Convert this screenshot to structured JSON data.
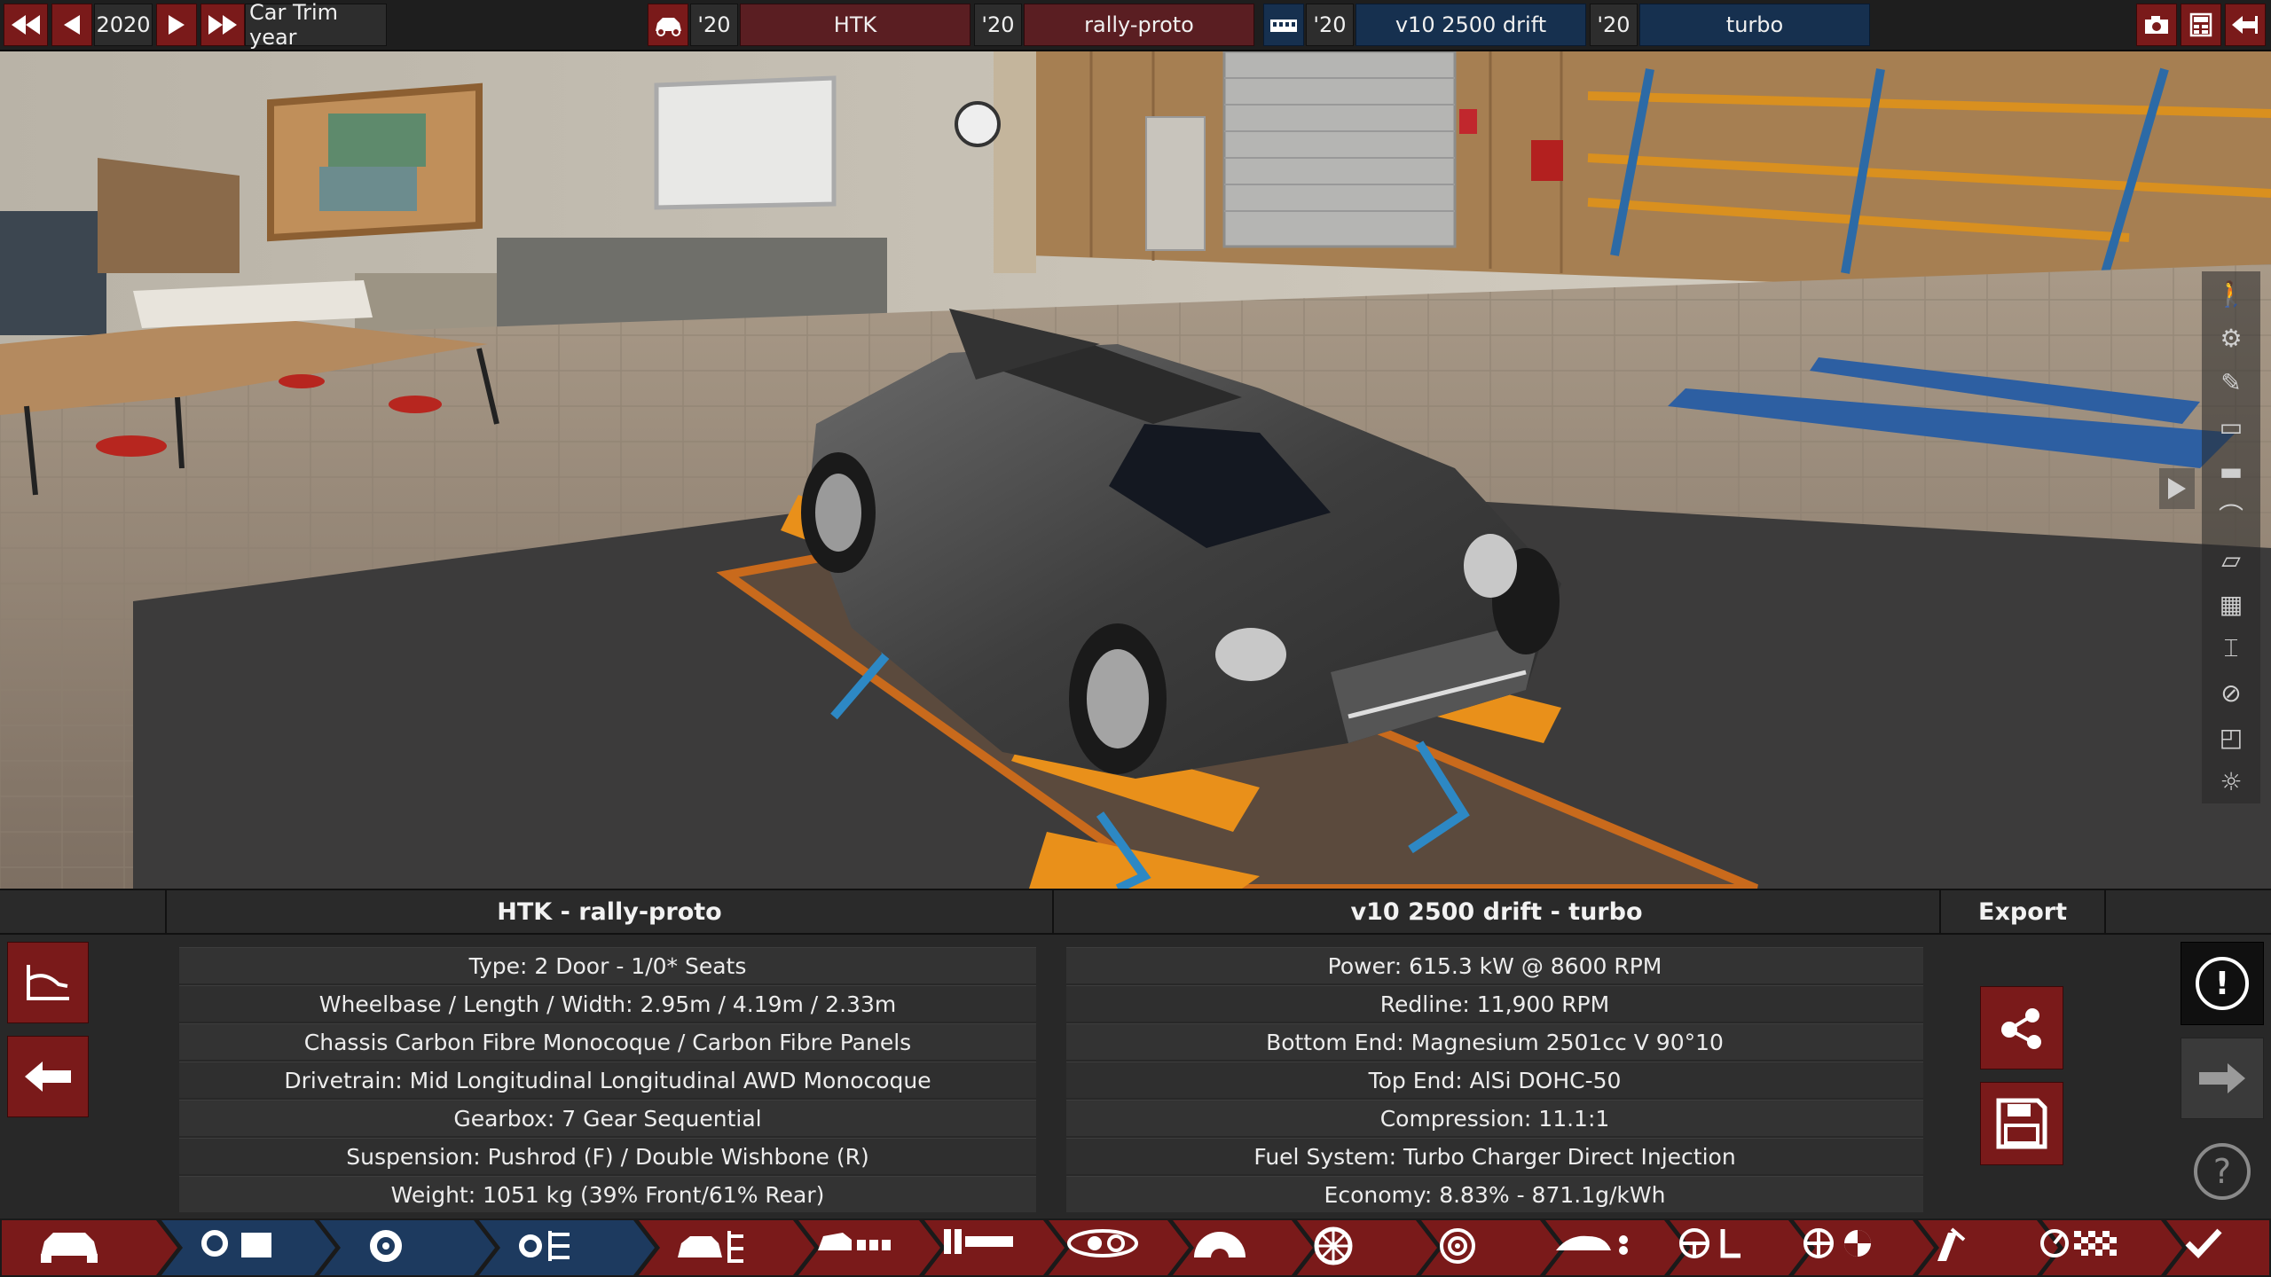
{
  "topbar": {
    "year": "2020",
    "trim_label": "Car Trim year",
    "car_year": "'20",
    "car_model": "HTK",
    "trim_year": "'20",
    "trim_name": "rally-proto",
    "engine_year": "'20",
    "engine_family": "v10 2500 drift",
    "variant_year": "'20",
    "engine_variant": "turbo"
  },
  "panel": {
    "car_title": "HTK - rally-proto",
    "car_specs": [
      "Type: 2 Door - 1/0* Seats",
      "Wheelbase / Length / Width: 2.95m / 4.19m / 2.33m",
      "Chassis Carbon Fibre Monocoque / Carbon Fibre Panels",
      "Drivetrain: Mid Longitudinal Longitudinal AWD Monocoque",
      "Gearbox: 7 Gear Sequential",
      "Suspension: Pushrod (F) / Double Wishbone (R)",
      "Weight: 1051 kg (39% Front/61% Rear)"
    ],
    "engine_title": "v10 2500 drift - turbo",
    "engine_specs": [
      "Power: 615.3 kW @ 8600 RPM",
      "Redline:  11,900 RPM",
      "Bottom End: Magnesium 2501cc V 90°10",
      "Top End: AlSi DOHC-50",
      "Compression: 11.1:1",
      "Fuel System: Turbo Charger Direct Injection",
      "Economy: 8.83% - 871.1g/kWh"
    ],
    "export_title": "Export"
  },
  "icons": {
    "exclaim": "!",
    "help": "?"
  },
  "colors": {
    "accent_red": "#7a1a1a",
    "nav_blue": "#1d3a5f",
    "nav_red": "#7a1a1a"
  }
}
